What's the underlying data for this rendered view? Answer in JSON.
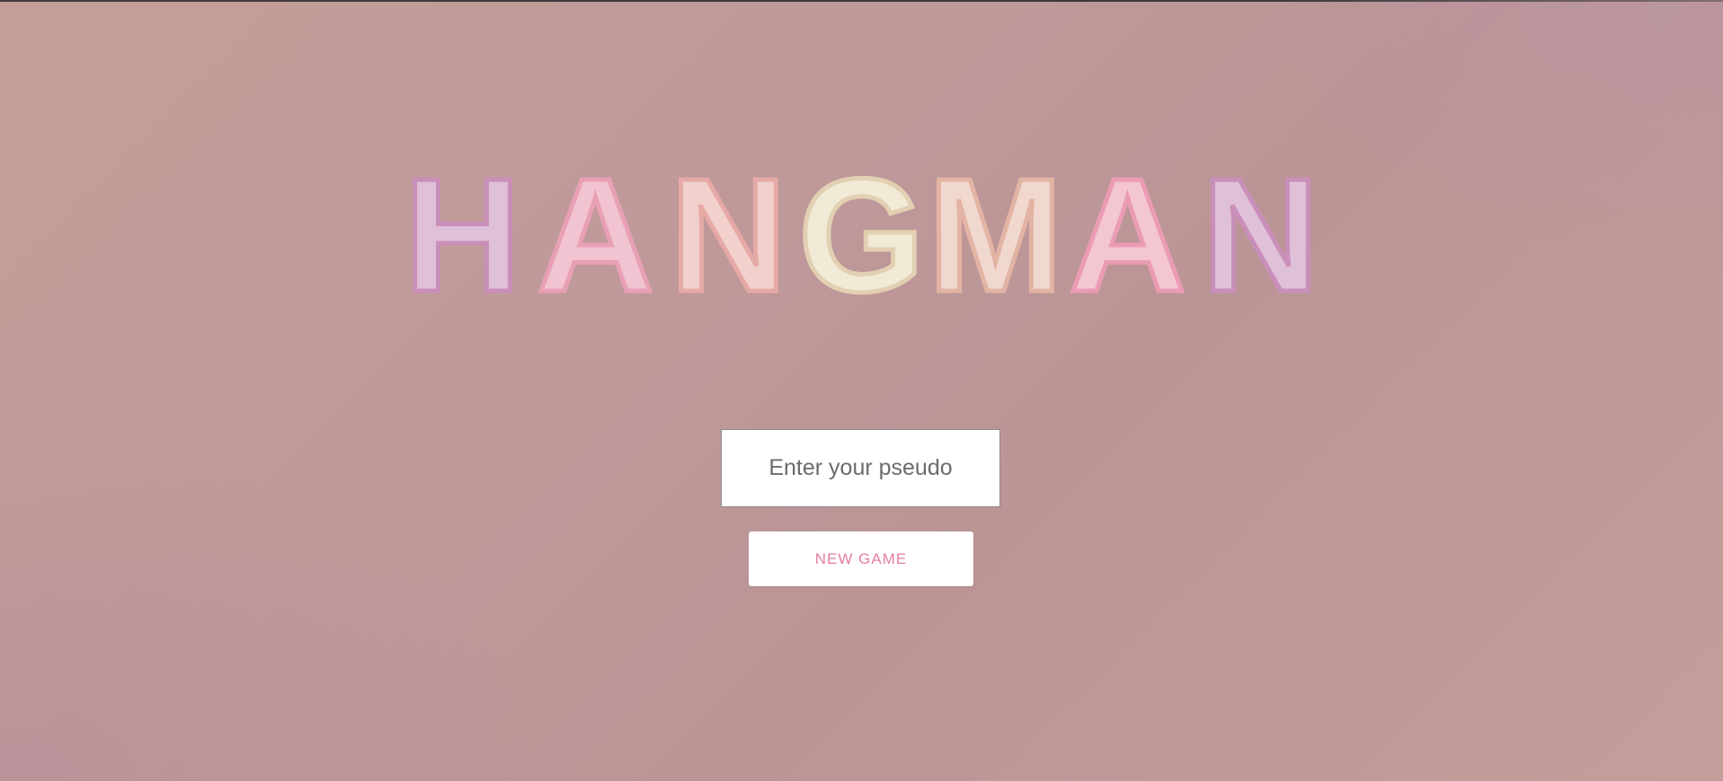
{
  "title": {
    "letters": [
      "H",
      "A",
      "N",
      "G",
      "M",
      "A",
      "N"
    ]
  },
  "form": {
    "pseudo_placeholder": "Enter your pseudo",
    "pseudo_value": "",
    "new_game_label": "NEW GAME"
  },
  "colors": {
    "background": "#bf989a",
    "button_text": "#e27ea0",
    "letter_fills": [
      "#e0bfd8",
      "#f2c3d0",
      "#f2d1cc",
      "#f0ead6",
      "#f0d8cf",
      "#f3c6d1",
      "#e0bfd8"
    ]
  }
}
